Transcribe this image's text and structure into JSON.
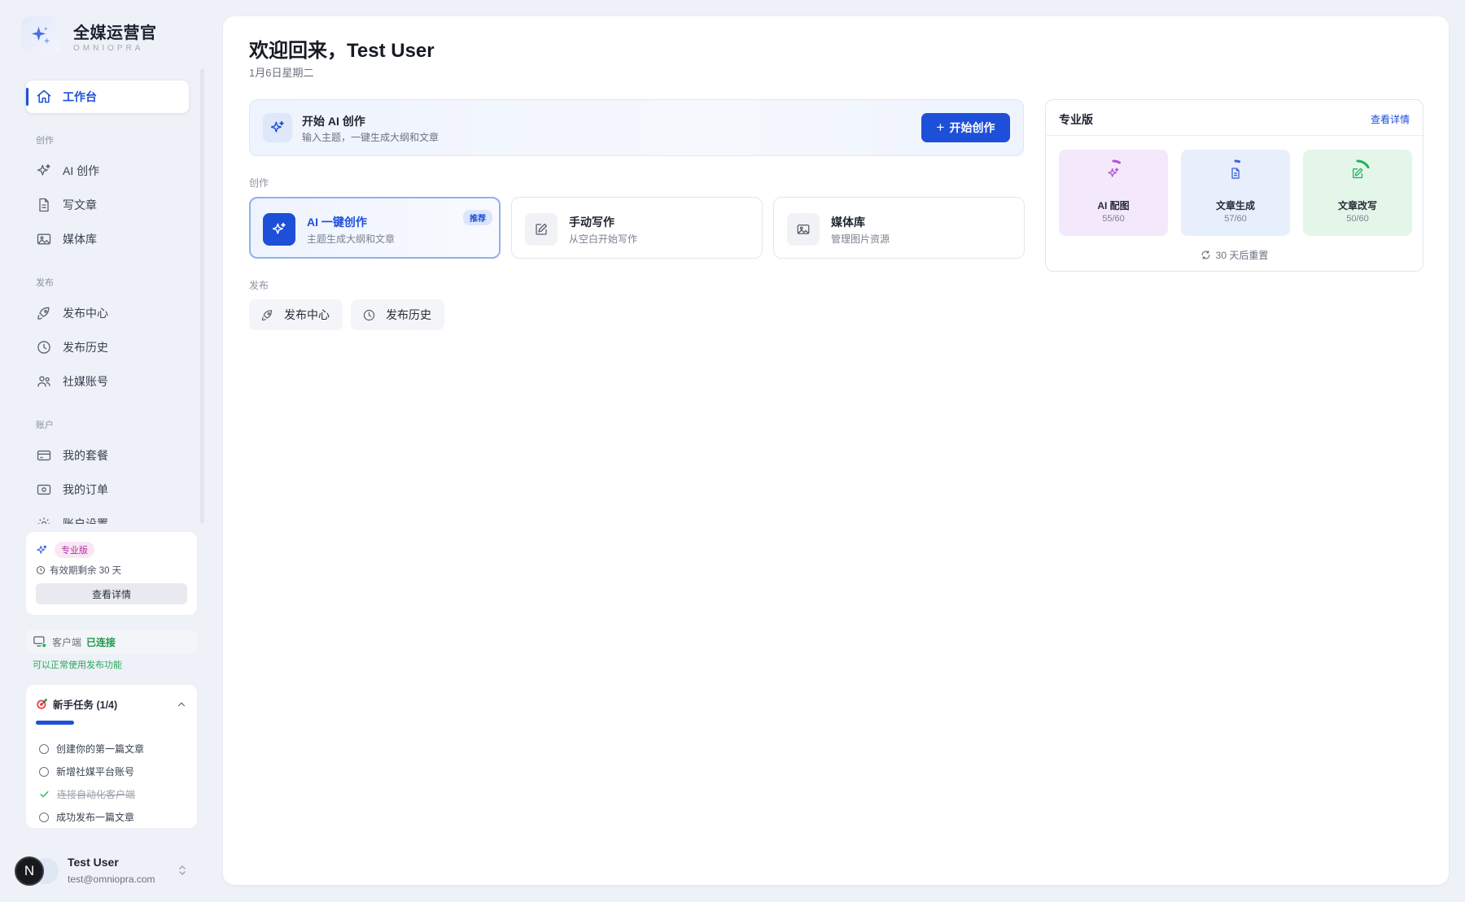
{
  "brand": {
    "name": "全媒运营官",
    "sub": "OMNIOPRA"
  },
  "nav": {
    "workbench": "工作台",
    "section_create": "创作",
    "ai_create": "AI 创作",
    "write_article": "写文章",
    "media_library": "媒体库",
    "section_publish": "发布",
    "publish_center": "发布中心",
    "publish_history": "发布历史",
    "social_accounts": "社媒账号",
    "section_account": "账户",
    "my_plan": "我的套餐",
    "my_orders": "我的订单",
    "account_settings": "账户设置"
  },
  "plan_card": {
    "badge": "专业版",
    "expiry": "有效期剩余 30 天",
    "button": "查看详情"
  },
  "client": {
    "label": "客户端",
    "status": "已连接",
    "note": "可以正常使用发布功能"
  },
  "tasks": {
    "title": "新手任务 (1/4)",
    "progress": 0.25,
    "items": [
      {
        "label": "创建你的第一篇文章",
        "done": false
      },
      {
        "label": "新增社媒平台账号",
        "done": false
      },
      {
        "label": "连接自动化客户端",
        "done": true
      },
      {
        "label": "成功发布一篇文章",
        "done": false
      }
    ]
  },
  "user": {
    "name": "Test User",
    "email": "test@omniopra.com",
    "avatar_letter": "N"
  },
  "main": {
    "greeting": "欢迎回来，Test User",
    "date": "1月6日星期二",
    "hero": {
      "title": "开始 AI 创作",
      "subtitle": "输入主题，一键生成大纲和文章",
      "button": "开始创作"
    },
    "section_create": "创作",
    "cards": [
      {
        "title": "AI 一键创作",
        "subtitle": "主题生成大纲和文章",
        "badge": "推荐"
      },
      {
        "title": "手动写作",
        "subtitle": "从空白开始写作"
      },
      {
        "title": "媒体库",
        "subtitle": "管理图片资源"
      }
    ],
    "section_publish": "发布",
    "pills": {
      "publish_center": "发布中心",
      "publish_history": "发布历史"
    }
  },
  "quota": {
    "title": "专业版",
    "link": "查看详情",
    "tiles": [
      {
        "label": "AI 配图",
        "value": "55/60",
        "used": 55,
        "total": 60,
        "color": "#b64fd6",
        "bg": "#f4e9fb"
      },
      {
        "label": "文章生成",
        "value": "57/60",
        "used": 57,
        "total": 60,
        "color": "#3b63d8",
        "bg": "#e7eefc"
      },
      {
        "label": "文章改写",
        "value": "50/60",
        "used": 50,
        "total": 60,
        "color": "#22b35a",
        "bg": "#e4f6ea"
      }
    ],
    "reset": "30 天后重置"
  },
  "colors": {
    "accent": "#1d4fd8",
    "success": "#1a9a4a"
  }
}
